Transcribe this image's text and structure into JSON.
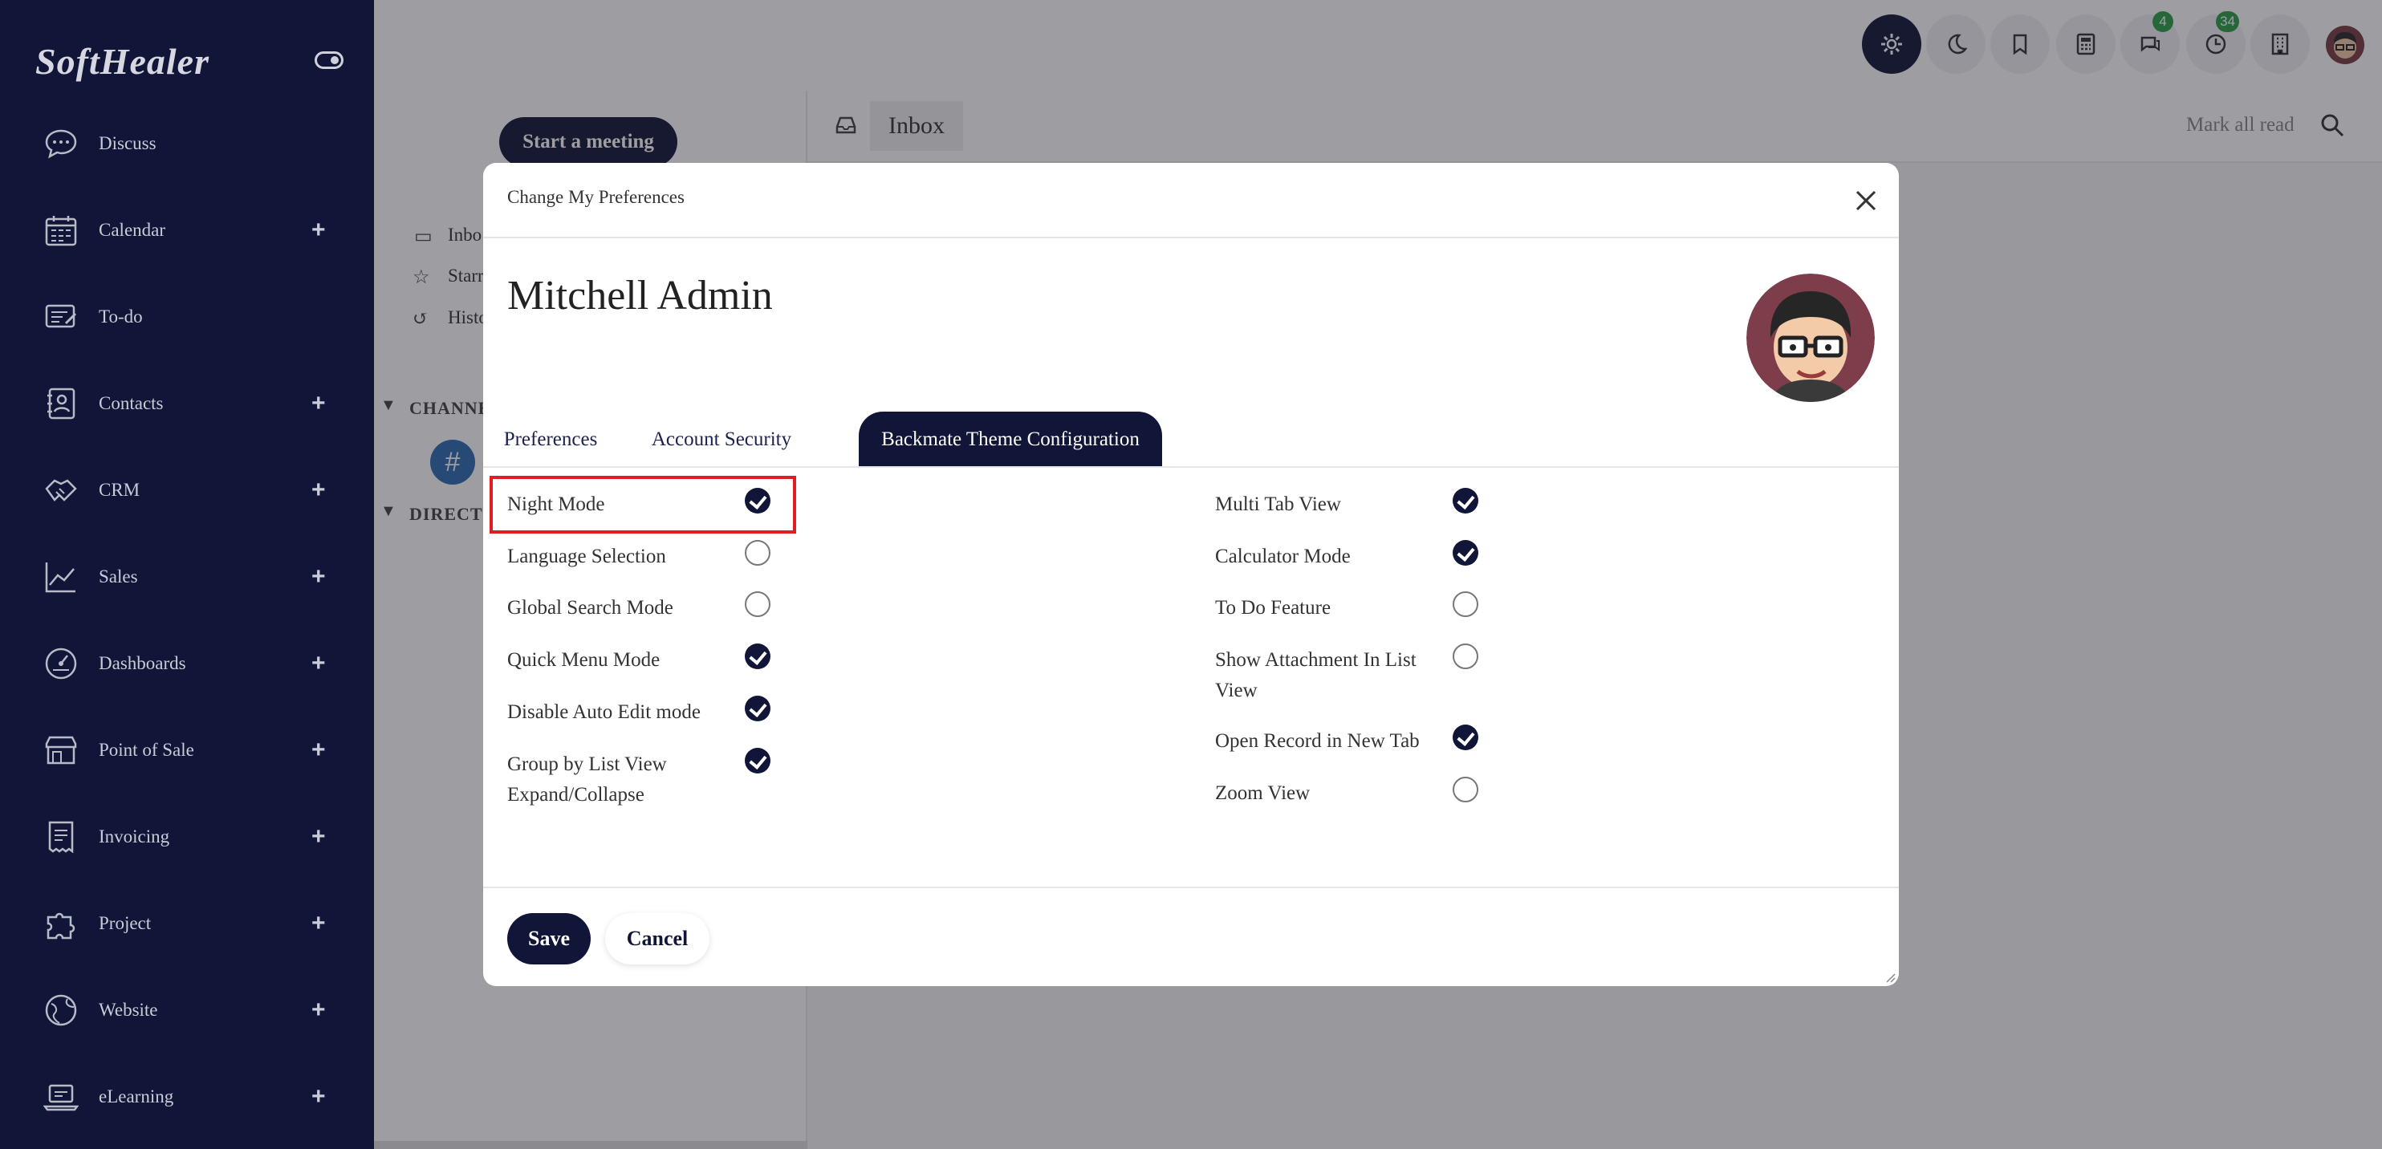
{
  "brand": {
    "logo": "SoftHealer"
  },
  "sidebar": {
    "items": [
      {
        "label": "Discuss",
        "icon": "chat-icon",
        "has_add": false
      },
      {
        "label": "Calendar",
        "icon": "calendar-icon",
        "has_add": true
      },
      {
        "label": "To-do",
        "icon": "todo-icon",
        "has_add": false
      },
      {
        "label": "Contacts",
        "icon": "contacts-icon",
        "has_add": true
      },
      {
        "label": "CRM",
        "icon": "handshake-icon",
        "has_add": true
      },
      {
        "label": "Sales",
        "icon": "chart-line-icon",
        "has_add": true
      },
      {
        "label": "Dashboards",
        "icon": "gauge-icon",
        "has_add": true
      },
      {
        "label": "Point of Sale",
        "icon": "store-icon",
        "has_add": true
      },
      {
        "label": "Invoicing",
        "icon": "receipt-icon",
        "has_add": true
      },
      {
        "label": "Project",
        "icon": "puzzle-icon",
        "has_add": true
      },
      {
        "label": "Website",
        "icon": "globe-icon",
        "has_add": true
      },
      {
        "label": "eLearning",
        "icon": "laptop-icon",
        "has_add": true
      }
    ],
    "add_symbol": "+"
  },
  "topbar": {
    "buttons": [
      {
        "icon": "gear-icon"
      },
      {
        "icon": "moon-icon"
      },
      {
        "icon": "bookmark-icon"
      },
      {
        "icon": "calculator-icon"
      },
      {
        "icon": "messages-icon",
        "badge": "4"
      },
      {
        "icon": "activity-clock-icon",
        "badge": "34"
      },
      {
        "icon": "building-icon"
      }
    ]
  },
  "discuss": {
    "start_meeting": "Start a meeting",
    "nav": [
      "Inbo",
      "Starr",
      "Histo"
    ],
    "sections": [
      "CHANNE",
      "DIRECT"
    ],
    "inbox_tab": "Inbox",
    "mark_all_read": "Mark all read"
  },
  "modal": {
    "title": "Change My Preferences",
    "user_name": "Mitchell Admin",
    "tabs": [
      "Preferences",
      "Account Security",
      "Backmate Theme Configuration"
    ],
    "active_tab": 2,
    "left_options": [
      {
        "label": "Night Mode",
        "checked": true
      },
      {
        "label": "Language Selection",
        "checked": false
      },
      {
        "label": "Global Search Mode",
        "checked": false
      },
      {
        "label": "Quick Menu Mode",
        "checked": true
      },
      {
        "label": "Disable Auto Edit mode",
        "checked": true
      },
      {
        "label": "Group by List View Expand/Collapse",
        "checked": true
      }
    ],
    "right_options": [
      {
        "label": "Multi Tab View",
        "checked": true
      },
      {
        "label": "Calculator Mode",
        "checked": true
      },
      {
        "label": "To Do Feature",
        "checked": false
      },
      {
        "label": "Show Attachment In List View",
        "checked": false
      },
      {
        "label": "Open Record in New Tab",
        "checked": true
      },
      {
        "label": "Zoom View",
        "checked": false
      }
    ],
    "save": "Save",
    "cancel": "Cancel"
  },
  "colors": {
    "primary": "#111638",
    "badge": "#2d9f48",
    "highlight": "#e11d24"
  }
}
